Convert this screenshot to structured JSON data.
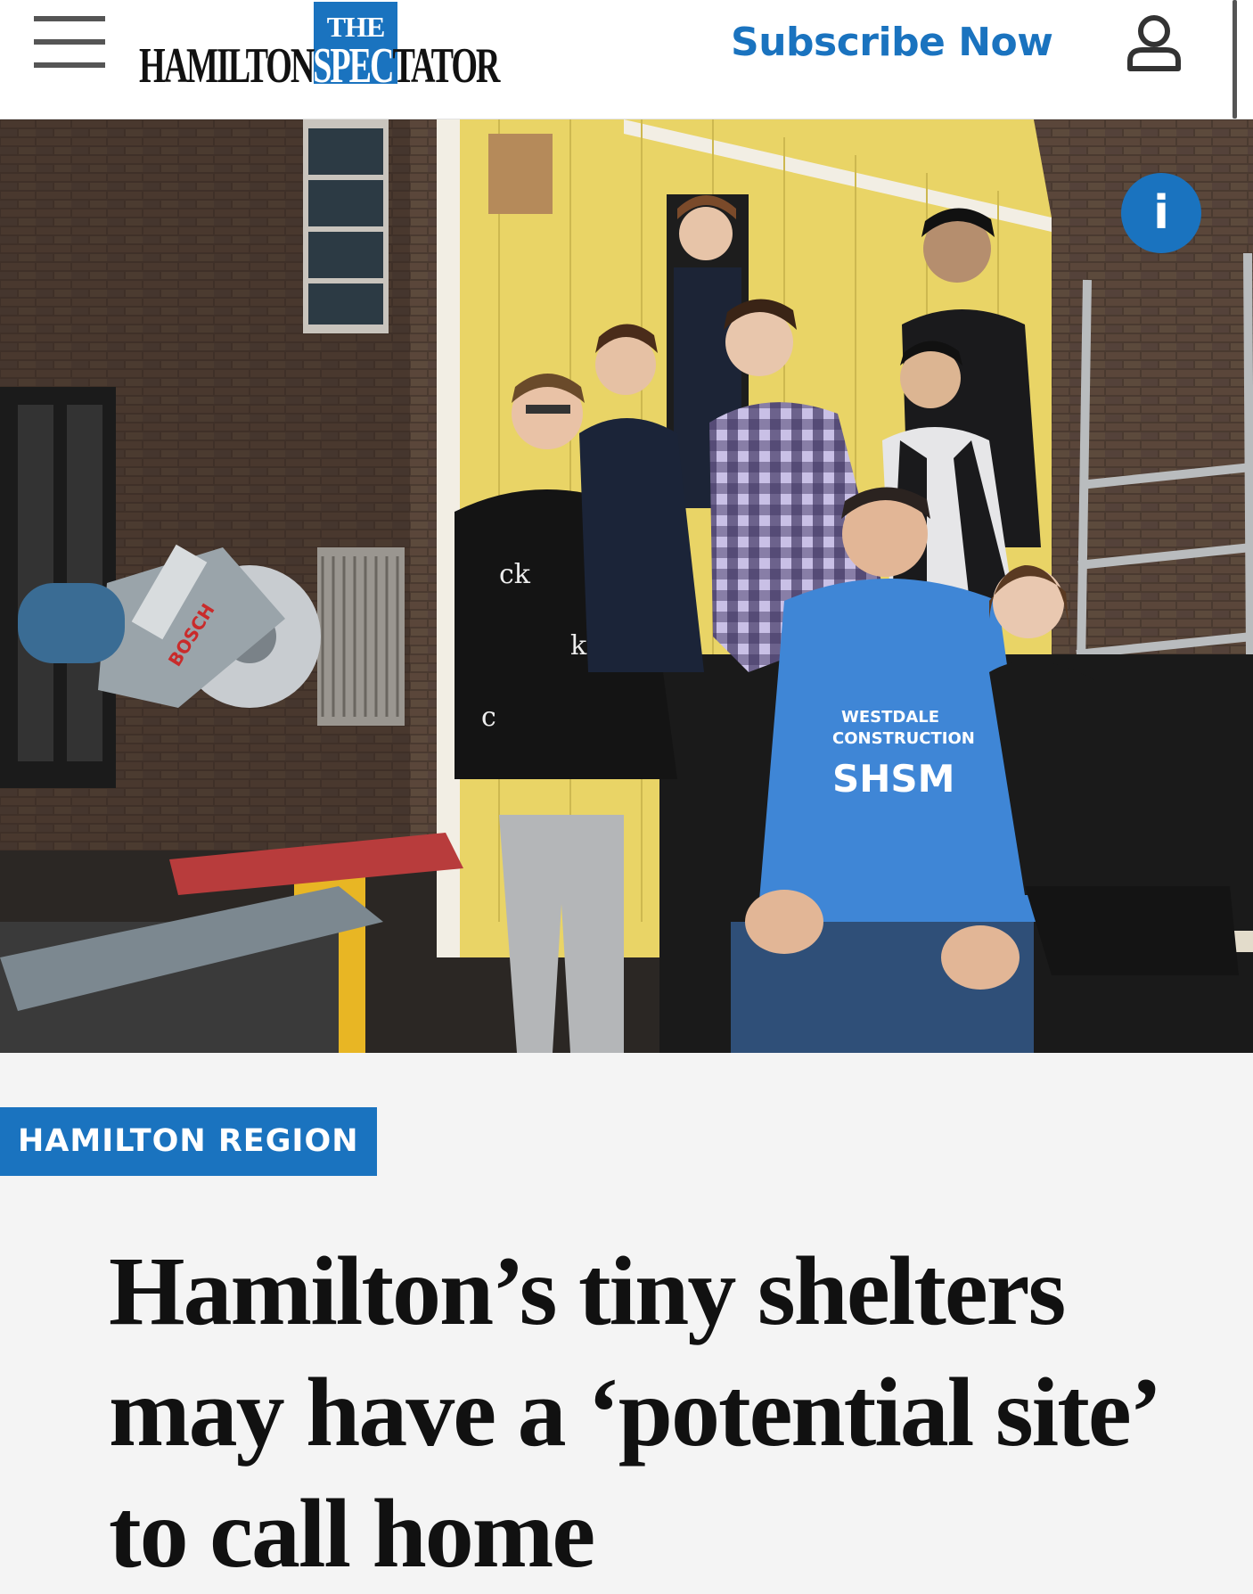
{
  "header": {
    "menu_icon": "hamburger-menu-icon",
    "logo": {
      "the": "THE",
      "word_part1": "HAMILTON",
      "word_part2": "SPEC",
      "word_part3": "TATOR",
      "brand_color": "#1a73bf"
    },
    "subscribe_label": "Subscribe Now",
    "account_icon": "user-account-icon"
  },
  "hero": {
    "info_label": "i",
    "info_icon": "info-icon",
    "photo_texts": {
      "saw_brand": "BOSCH",
      "hoodie_line1": "WESTDALE",
      "hoodie_line2": "CONSTRUCTION",
      "hoodie_logo": "SHSM"
    }
  },
  "article": {
    "category": "HAMILTON REGION",
    "headline": "Hamilton’s tiny shelters may have a ‘potential site’ to call home"
  },
  "colors": {
    "accent": "#1a73bf",
    "headline_text": "#111111",
    "background": "#f4f4f4"
  }
}
